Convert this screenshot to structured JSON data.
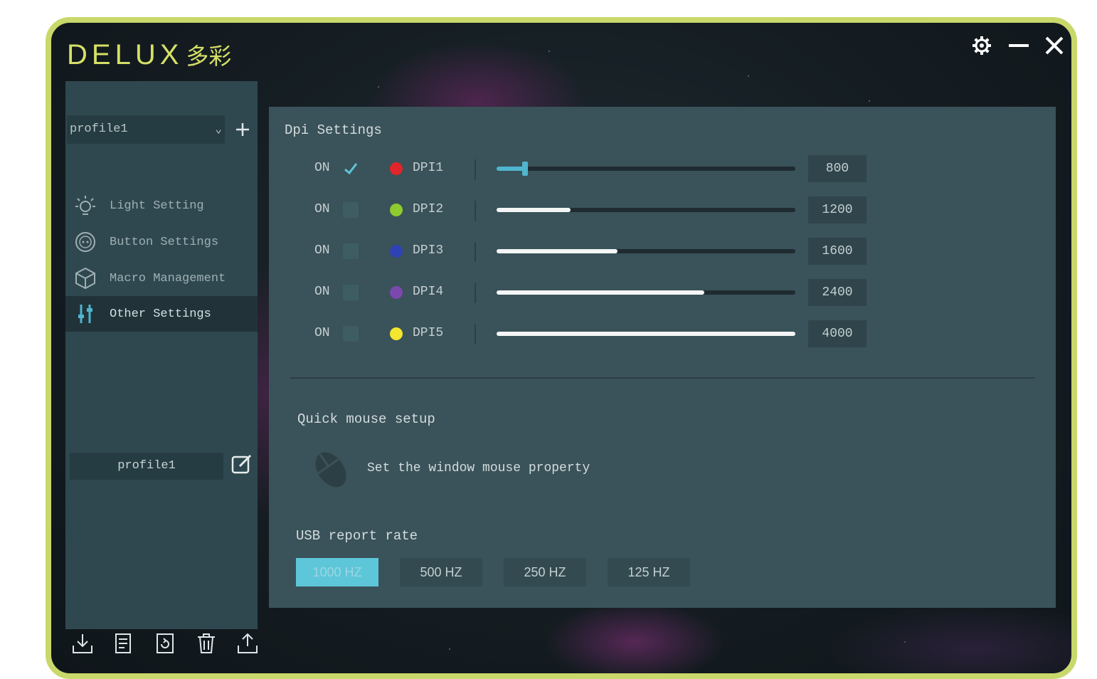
{
  "app": {
    "logo_latin": "DELUX",
    "logo_cn": "多彩"
  },
  "sidebar": {
    "profile_select": "profile1",
    "items": [
      {
        "label": "Light Setting",
        "icon": "sun-icon"
      },
      {
        "label": "Button Settings",
        "icon": "button-icon"
      },
      {
        "label": "Macro Management",
        "icon": "cube-icon"
      },
      {
        "label": "Other Settings",
        "icon": "sliders-icon",
        "active": true
      }
    ],
    "profile_name": "profile1",
    "bottom_icons": [
      "import-icon",
      "save-icon",
      "reset-icon",
      "trash-icon",
      "export-icon"
    ]
  },
  "dpi": {
    "title": "Dpi Settings",
    "on_label": "ON",
    "levels": [
      {
        "name": "DPI1",
        "value": "800",
        "color": "#e0262a",
        "checked": true,
        "fill": 0.1
      },
      {
        "name": "DPI2",
        "value": "1200",
        "color": "#8ecb2f",
        "checked": false,
        "fill": 0.25
      },
      {
        "name": "DPI3",
        "value": "1600",
        "color": "#2f42b5",
        "checked": false,
        "fill": 0.4
      },
      {
        "name": "DPI4",
        "value": "2400",
        "color": "#7b48b0",
        "checked": false,
        "fill": 0.7
      },
      {
        "name": "DPI5",
        "value": "4000",
        "color": "#f2e62e",
        "checked": false,
        "fill": 1.0
      }
    ]
  },
  "quick_setup": {
    "title": "Quick mouse setup",
    "link": "Set the window mouse property"
  },
  "usb": {
    "title": "USB report rate",
    "options": [
      "1000 HZ",
      "500 HZ",
      "250 HZ",
      "125 HZ"
    ],
    "selected": "1000 HZ"
  },
  "colors": {
    "accent": "#5ec6d9",
    "frame": "#c9d86a",
    "logo": "#d6e066"
  }
}
